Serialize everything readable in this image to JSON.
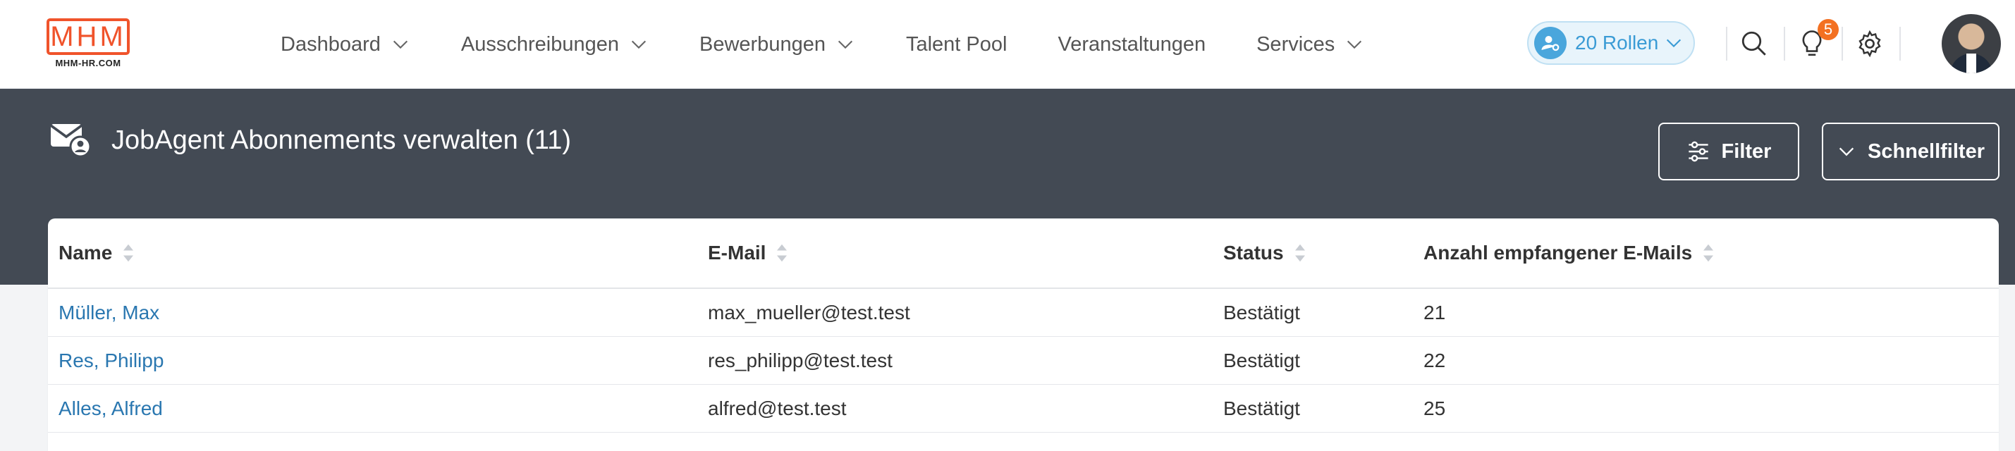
{
  "logo": {
    "text": "MHM",
    "subtitle": "MHM-HR.COM"
  },
  "nav": {
    "items": [
      {
        "label": "Dashboard",
        "dropdown": true
      },
      {
        "label": "Ausschreibungen",
        "dropdown": true
      },
      {
        "label": "Bewerbungen",
        "dropdown": true
      },
      {
        "label": "Talent Pool",
        "dropdown": false
      },
      {
        "label": "Veranstaltungen",
        "dropdown": false
      },
      {
        "label": "Services",
        "dropdown": true
      }
    ]
  },
  "roles": {
    "label": "20 Rollen"
  },
  "notifications": {
    "count": "5"
  },
  "header": {
    "title": "JobAgent Abonnements verwalten (11)",
    "filter_label": "Filter",
    "quickfilter_label": "Schnellfilter"
  },
  "table": {
    "columns": [
      "Name",
      "E-Mail",
      "Status",
      "Anzahl empfangener E-Mails"
    ],
    "rows": [
      {
        "name": "Müller, Max",
        "email": "max_mueller@test.test",
        "status": "Bestätigt",
        "count": "21"
      },
      {
        "name": "Res, Philipp",
        "email": "res_philipp@test.test",
        "status": "Bestätigt",
        "count": "22"
      },
      {
        "name": "Alles, Alfred",
        "email": "alfred@test.test",
        "status": "Bestätigt",
        "count": "25"
      }
    ]
  },
  "colors": {
    "brand": "#f0532b",
    "header_band": "#434a54",
    "link": "#2a77b0",
    "accent": "#3a9bd5",
    "badge": "#f37021"
  }
}
